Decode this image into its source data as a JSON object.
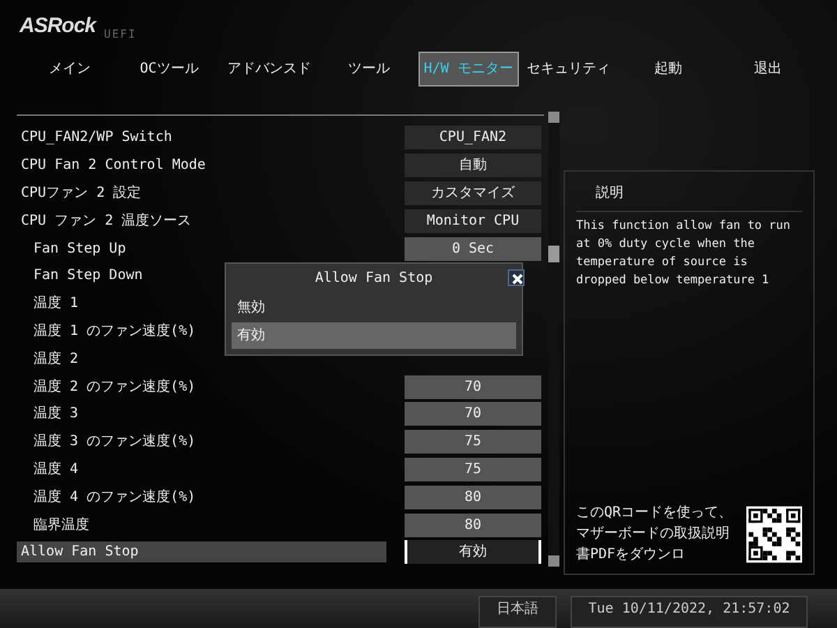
{
  "header": {
    "logo": "ASRock",
    "subtitle": "UEFI"
  },
  "tabs": [
    {
      "label": "メイン",
      "selected": false
    },
    {
      "label": "OCツール",
      "selected": false
    },
    {
      "label": "アドバンスド",
      "selected": false
    },
    {
      "label": "ツール",
      "selected": false
    },
    {
      "label": "H/W モニター",
      "selected": true
    },
    {
      "label": "セキュリティ",
      "selected": false
    },
    {
      "label": "起動",
      "selected": false
    },
    {
      "label": "退出",
      "selected": false
    }
  ],
  "settings": [
    {
      "label": "CPU_FAN2/WP Switch",
      "value": "CPU_FAN2",
      "indented": false,
      "selected": false
    },
    {
      "label": "CPU Fan 2 Control Mode",
      "value": "自動",
      "indented": false,
      "selected": false
    },
    {
      "label": "CPUファン 2 設定",
      "value": "カスタマイズ",
      "indented": false,
      "selected": false
    },
    {
      "label": "CPU ファン 2 温度ソース",
      "value": "Monitor CPU",
      "indented": false,
      "selected": false
    },
    {
      "label": "Fan Step Up",
      "value": "0 Sec",
      "indented": true,
      "selected": false
    },
    {
      "label": "Fan Step Down",
      "indented": true,
      "selected": false
    },
    {
      "label": "温度 1",
      "indented": true,
      "selected": false
    },
    {
      "label": "温度 1 のファン速度(%)",
      "indented": true,
      "selected": false
    },
    {
      "label": "温度 2",
      "indented": true,
      "selected": false
    },
    {
      "label": "温度 2 のファン速度(%)",
      "value": "70",
      "indented": true,
      "selected": false
    },
    {
      "label": "温度 3",
      "value": "70",
      "indented": true,
      "selected": false
    },
    {
      "label": "温度 3 のファン速度(%)",
      "value": "75",
      "indented": true,
      "selected": false
    },
    {
      "label": "温度 4",
      "value": "75",
      "indented": true,
      "selected": false
    },
    {
      "label": "温度 4 のファン速度(%)",
      "value": "80",
      "indented": true,
      "selected": false
    },
    {
      "label": "臨界温度",
      "value": "80",
      "indented": true,
      "selected": false
    },
    {
      "label": "Allow Fan Stop",
      "value": "有効",
      "indented": false,
      "selected": true
    }
  ],
  "dialog": {
    "title": "Allow Fan Stop",
    "options": [
      {
        "label": "無効",
        "selected": false
      },
      {
        "label": "有効",
        "selected": true
      }
    ]
  },
  "description": {
    "title": "説明",
    "text": "This function allow fan to run at 0% duty cycle when the temperature of source is dropped below temperature 1",
    "qr_text": "このQRコードを使って、マザーボードの取扱説明書PDFをダウンロ"
  },
  "status_bar": {
    "language": "日本語",
    "datetime": "Tue 10/11/2022, 21:57:02"
  }
}
